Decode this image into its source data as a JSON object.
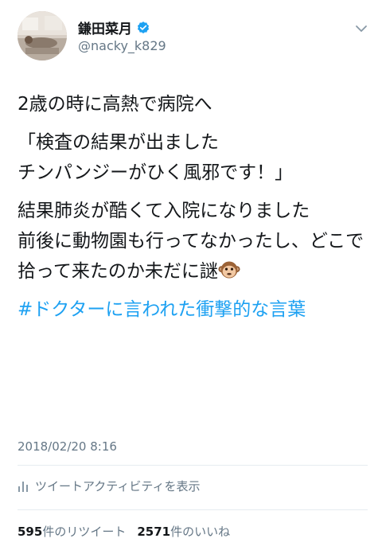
{
  "profile": {
    "display_name": "鎌田菜月",
    "handle": "@nacky_k829",
    "avatar_desc": "user avatar photo",
    "verified_color": "#1da1f2"
  },
  "tweet": {
    "line1": "2歳の時に高熱で病院へ",
    "quote": "「検査の結果が出ました\nチンパンジーがひく風邪です！」",
    "body": "結果肺炎が酷くて入院になりました\n前後に動物園も行ってなかったし、どこで拾って来たのか未だに謎",
    "emoji": "monkey-face",
    "hashtag": "#ドクターに言われた衝撃的な言葉"
  },
  "timestamp": "2018/02/20 8:16",
  "activity_label": "ツイートアクティビティを表示",
  "stats": {
    "retweets_count": "595",
    "retweets_label": "件のリツイート",
    "likes_count": "2571",
    "likes_label": "件のいいね"
  },
  "colors": {
    "accent": "#1da1f2",
    "secondary_text": "#657786",
    "divider": "#e6ecf0"
  }
}
